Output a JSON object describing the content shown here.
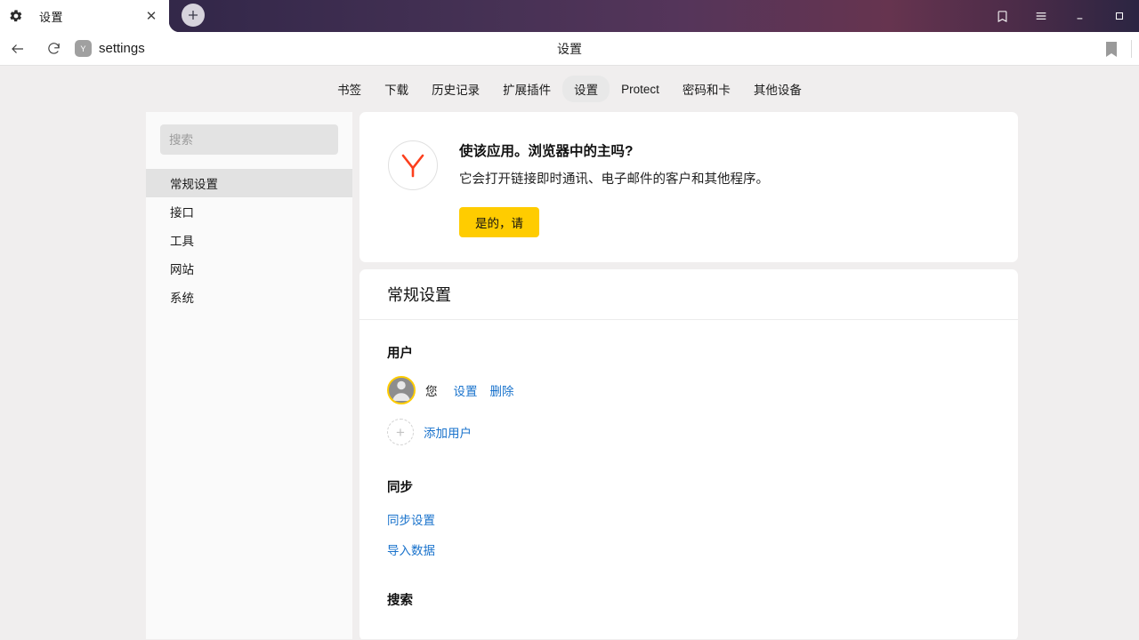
{
  "titlebar": {
    "gear_icon": "gear-icon",
    "tab_label": "设置",
    "close_label": "✕",
    "newtab_label": "+",
    "controls": [
      {
        "name": "collections-button",
        "icon": "bookmark-collections-icon"
      },
      {
        "name": "menu-button",
        "icon": "hamburger-menu-icon"
      },
      {
        "name": "minimize-button",
        "icon": "minimize-icon"
      },
      {
        "name": "maximize-button",
        "icon": "maximize-icon"
      }
    ]
  },
  "addressbar": {
    "back_icon": "back-arrow-icon",
    "reload_icon": "reload-icon",
    "favicon_letter": "Y",
    "url": "settings",
    "page_title": "设置",
    "bookmark_icon": "bookmark-filled-icon"
  },
  "topnav": {
    "items": [
      {
        "label": "书签",
        "selected": false
      },
      {
        "label": "下载",
        "selected": false
      },
      {
        "label": "历史记录",
        "selected": false
      },
      {
        "label": "扩展插件",
        "selected": false
      },
      {
        "label": "设置",
        "selected": true
      },
      {
        "label": "Protect",
        "selected": false
      },
      {
        "label": "密码和卡",
        "selected": false
      },
      {
        "label": "其他设备",
        "selected": false
      }
    ]
  },
  "sidebar": {
    "search_placeholder": "搜索",
    "search_value": "",
    "items": [
      {
        "label": "常规设置",
        "selected": true
      },
      {
        "label": "接口",
        "selected": false
      },
      {
        "label": "工具",
        "selected": false
      },
      {
        "label": "网站",
        "selected": false
      },
      {
        "label": "系统",
        "selected": false
      }
    ]
  },
  "promo": {
    "logo_letter": "Y",
    "title": "使该应用。浏览器中的主吗?",
    "description": "它会打开链接即时通讯、电子邮件的客户和其他程序。",
    "button_label": "是的，请"
  },
  "settings_card": {
    "header": "常规设置",
    "users": {
      "title": "用户",
      "current_user": "您",
      "settings_link": "设置",
      "delete_link": "删除",
      "add_user_link": "添加用户",
      "plus_glyph": "+"
    },
    "sync": {
      "title": "同步",
      "links": [
        "同步设置",
        "导入数据"
      ]
    },
    "search": {
      "title": "搜索"
    }
  },
  "colors": {
    "accent_yellow": "#ffcc00",
    "link_blue": "#1a73cc",
    "page_bg": "#f0eeee",
    "sidebar_bg": "#fafafa",
    "yandex_red": "#fc3f1d"
  }
}
